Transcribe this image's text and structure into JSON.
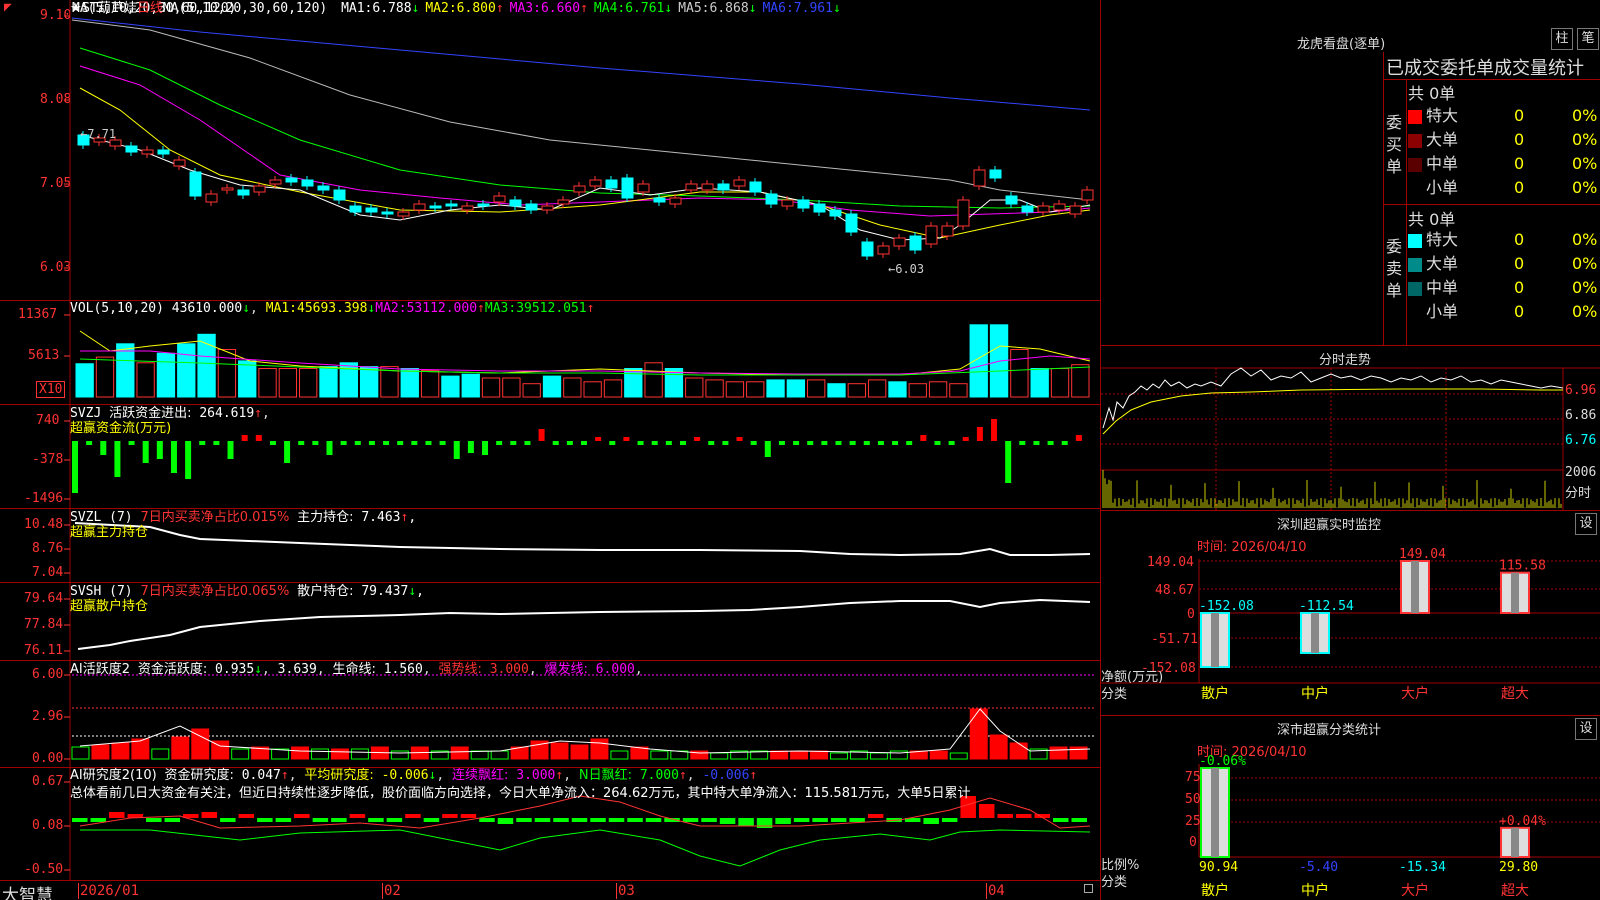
{
  "app": {
    "brand": "大智慧"
  },
  "kline": {
    "indicator": "MA(5,10,20,30,60,120)",
    "stock_name": "★ST葫芦娃",
    "period": "日线",
    "ma": [
      {
        "label": "MA1:",
        "value": "6.788",
        "arrow": "↓",
        "color": "#ffffff"
      },
      {
        "label": "MA2:",
        "value": "6.800",
        "arrow": "↑",
        "color": "#ffff00"
      },
      {
        "label": "MA3:",
        "value": "6.660",
        "arrow": "↑",
        "color": "#ff00ff"
      },
      {
        "label": "MA4:",
        "value": "6.761",
        "arrow": "↓",
        "color": "#00ff00"
      },
      {
        "label": "MA5:",
        "value": "6.868",
        "arrow": "↓",
        "color": "#cccccc"
      },
      {
        "label": "MA6:",
        "value": "7.961",
        "arrow": "↓",
        "color": "#3344ff"
      }
    ],
    "y_ticks": [
      "9.10",
      "8.08",
      "7.05",
      "6.03"
    ],
    "high_marker": "←7.71",
    "low_marker": "←6.03"
  },
  "vol": {
    "indicator": "VOL(5,10,20)",
    "value": "43610.000",
    "arrow": "↓",
    "ma": [
      {
        "label": "MA1:",
        "value": "45693.398",
        "arrow": "↓",
        "color": "#ffff00"
      },
      {
        "label": "MA2:",
        "value": "53112.000",
        "arrow": "↑",
        "color": "#ff00ff"
      },
      {
        "label": "MA3:",
        "value": "39512.051",
        "arrow": "↑",
        "color": "#00ff00"
      }
    ],
    "y_ticks": [
      "11367",
      "5613"
    ],
    "multiplier": "X10"
  },
  "svzj": {
    "name": "SVZJ",
    "title": "活跃资金进出:",
    "value": "264.619",
    "arrow": "↑",
    "subtitle": "超赢资金流(万元)",
    "y_ticks": [
      "740",
      "-378",
      "-1496"
    ]
  },
  "svzl": {
    "name": "SVZL (7)",
    "ratio_label": "7日内买卖净占比0.015%",
    "holding_label": "主力持仓:",
    "holding_value": "7.463",
    "arrow": "↑",
    "trail": ",",
    "subtitle": "超赢主力持仓",
    "y_ticks": [
      "10.48",
      "8.76",
      "7.04"
    ]
  },
  "svsh": {
    "name": "SVSH (7)",
    "ratio_label": "7日内买卖净占比0.065%",
    "holding_label": "散户持仓:",
    "holding_value": "79.437",
    "arrow": "↓",
    "trail": ",",
    "subtitle": "超赢散户持仓",
    "y_ticks": [
      "79.64",
      "77.84",
      "76.11"
    ]
  },
  "ai_active": {
    "name": "AI活跃度2",
    "l1": "资金活跃度:",
    "v1": "0.935",
    "a1": "↓",
    "v2": "3.639",
    "l3": "生命线:",
    "v3": "1.560",
    "l4": "强势线:",
    "v4": "3.000",
    "l5": "爆发线:",
    "v5": "6.000",
    "y_ticks": [
      "6.00",
      "2.96",
      "0.00"
    ]
  },
  "ai_research": {
    "name": "AI研究度2(10)",
    "l1": "资金研究度:",
    "v1": "0.047",
    "a1": "↑",
    "l2": "平均研究度:",
    "v2": "-0.006",
    "a2": "↓",
    "l3": "连续飘红:",
    "v3": "3.000",
    "a3": "↑",
    "l4": "N日飘红:",
    "v4": "7.000",
    "a4": "↑",
    "v5": "-0.006",
    "a5": "↑",
    "summary": "总体看前几日大资金有关注，但近日持续性逐步降低，股价面临方向选择，今日大单净流入：264.62万元，其中特大单净流入：115.581万元，大单5日累计",
    "y_ticks": [
      "0.67",
      "0.08",
      "-0.50"
    ]
  },
  "date_axis": [
    "2026/01",
    "02",
    "03",
    "04"
  ],
  "lhb": {
    "title": "龙虎看盘(逐单)",
    "btn_a": "柱",
    "btn_b": "笔",
    "header": "已成交委托单成交量统计",
    "buy_label": "委买单",
    "sell_label": "委卖单",
    "buy_total": "共 0单",
    "sell_total": "共 0单",
    "buy_rows": [
      {
        "name": "特大",
        "count": "0",
        "pct": "0%",
        "color": "#ff0000"
      },
      {
        "name": "大单",
        "count": "0",
        "pct": "0%",
        "color": "#8b0000"
      },
      {
        "name": "中单",
        "count": "0",
        "pct": "0%",
        "color": "#5a0000"
      },
      {
        "name": "小单",
        "count": "0",
        "pct": "0%",
        "color": "#000000"
      }
    ],
    "sell_rows": [
      {
        "name": "特大",
        "count": "0",
        "pct": "0%",
        "color": "#00ffff"
      },
      {
        "name": "大单",
        "count": "0",
        "pct": "0%",
        "color": "#008b8b"
      },
      {
        "name": "中单",
        "count": "0",
        "pct": "0%",
        "color": "#006666"
      },
      {
        "name": "小单",
        "count": "0",
        "pct": "0%",
        "color": "#000000"
      }
    ]
  },
  "intraday": {
    "title": "分时走势",
    "y_ticks": [
      "6.96",
      "6.86",
      "6.76"
    ],
    "vol_tick": "2006",
    "vol_unit": "分时"
  },
  "sz_monitor": {
    "title": "深圳超赢实时监控",
    "btn": "设",
    "time_label": "时间:",
    "time": "2026/04/10",
    "y_ticks": [
      "149.04",
      "48.67",
      "0",
      "-51.71",
      "-152.08"
    ],
    "y_label": "净额(万元)",
    "x_label": "分类",
    "categories": [
      "散户",
      "中户",
      "大户",
      "超大"
    ],
    "values": [
      -152.08,
      -112.54,
      149.04,
      115.58
    ],
    "value_labels": [
      "-152.08",
      "-112.54",
      "149.04",
      "115.58"
    ]
  },
  "sz_class": {
    "title": "深市超赢分类统计",
    "btn": "设",
    "time_label": "时间:",
    "time": "2026/04/10",
    "y_ticks": [
      "75",
      "50",
      "25",
      "0"
    ],
    "y_label": "比例%",
    "x_label": "分类",
    "categories": [
      "散户",
      "中户",
      "大户",
      "超大"
    ],
    "values": [
      90.94,
      -5.4,
      -15.34,
      29.8
    ],
    "value_labels": [
      "90.94",
      "-5.40",
      "-15.34",
      "29.80"
    ],
    "delta_labels": [
      "-0.06%",
      "",
      "",
      "+0.04%"
    ]
  },
  "colors": {
    "up": "#ff3333",
    "down": "#00ffff",
    "border": "#a00000"
  }
}
